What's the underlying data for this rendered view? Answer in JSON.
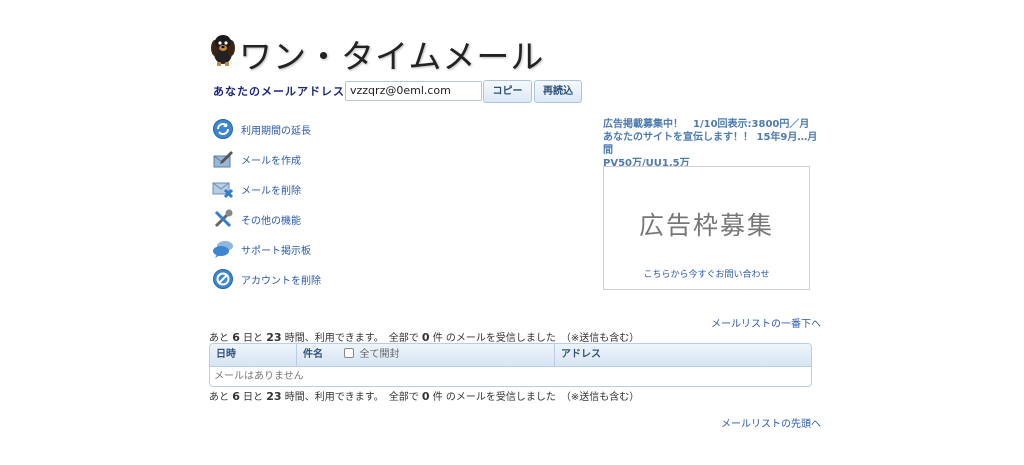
{
  "header": {
    "title": "ワン・タイムメール"
  },
  "address": {
    "label": "あなたのメールアドレス",
    "value": "vzzqrz@0eml.com",
    "copy_label": "コピー",
    "reload_label": "再読込"
  },
  "menu": {
    "items": [
      {
        "label": "利用期間の延長",
        "icon": "refresh-icon"
      },
      {
        "label": "メールを作成",
        "icon": "compose-icon"
      },
      {
        "label": "メールを削除",
        "icon": "mail-delete-icon"
      },
      {
        "label": "その他の機能",
        "icon": "tools-icon"
      },
      {
        "label": "サポート掲示板",
        "icon": "chat-icon"
      },
      {
        "label": "アカウントを削除",
        "icon": "ban-icon"
      }
    ]
  },
  "ad": {
    "line1": "広告掲載募集中！　1/10回表示:3800円／月",
    "line2": "あなたのサイトを宣伝します！！ 15年9月…月間",
    "line3": "PV50万/UU1.5万",
    "box_title": "広告枠募集",
    "box_link": "こちらから今すぐお問い合わせ"
  },
  "links": {
    "to_bottom": "メールリストの一番下へ",
    "to_top": "メールリストの先頭へ"
  },
  "status": {
    "prefix": "あと",
    "days": "6",
    "days_unit": "日と",
    "hours": "23",
    "hours_unit": "時間、利用できます。　全部で",
    "count": "0",
    "suffix": "件 のメールを受信しました　（※送信も含む）"
  },
  "table": {
    "col_date": "日時",
    "col_subject": "件名",
    "check_all_label": "全て開封",
    "col_address": "アドレス",
    "empty_message": "メールはありません"
  },
  "colors": {
    "accent": "#2b59b0",
    "table_border": "#b9cee6"
  }
}
